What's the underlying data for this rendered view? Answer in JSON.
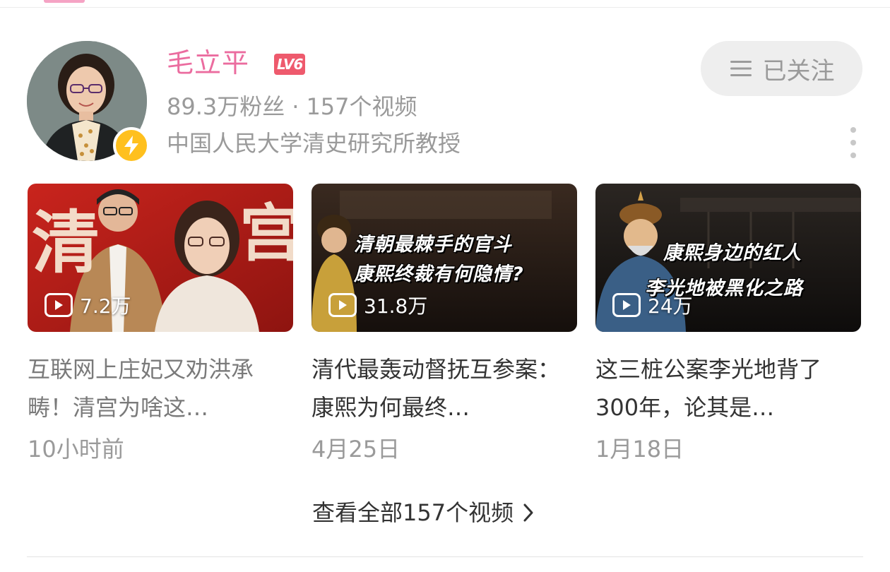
{
  "profile": {
    "name": "毛立平",
    "level": "LV6",
    "fans": "89.3万粉丝",
    "separator": "·",
    "video_count": "157个视频",
    "bio": "中国人民大学清史研究所教授"
  },
  "follow_button": {
    "label": "已关注"
  },
  "videos": [
    {
      "thumbnail_text": [
        "清",
        "宫"
      ],
      "views": "7.2万",
      "title": "互联网上庄妃又劝洪承畴！清宫为啥这…",
      "date": "10小时前"
    },
    {
      "thumbnail_text": [
        "清朝最棘手的官斗",
        "康熙终裁有何隐情?"
      ],
      "views": "31.8万",
      "title": "清代最轰动督抚互参案：康熙为何最终…",
      "date": "4月25日"
    },
    {
      "thumbnail_text": [
        "康熙身边的红人",
        "李光地被黑化之路"
      ],
      "views": "24万",
      "title": "这三桩公案李光地背了300年，论其是…",
      "date": "1月18日"
    }
  ],
  "view_all": {
    "label": "查看全部157个视频"
  },
  "colors": {
    "name": "#eb6c9f",
    "level_badge": "#ee5a6d",
    "verify_badge": "#ffc01e",
    "muted_text": "#9a9a9a",
    "primary_text": "#333333"
  },
  "icons": [
    "lightning-icon",
    "menu-lines-icon",
    "more-vertical-icon",
    "play-icon",
    "chevron-right-icon"
  ]
}
